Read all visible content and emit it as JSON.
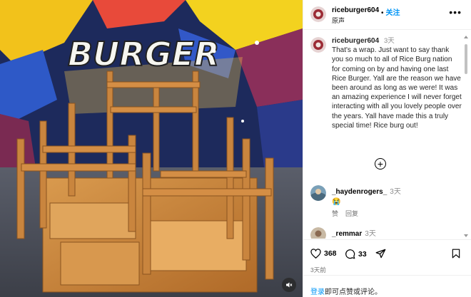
{
  "post": {
    "username": "riceburger604",
    "follow_label": "关注",
    "follow_separator": "•",
    "original_label": "原声",
    "caption": "That's a wrap. Just want to say thank you so much to all of Rice Burg nation for coming on by and having one last Rice Burger. Yall are the reason we have been around as long as we were! It was an amazing experience I will never forget interacting with all you lovely people over the years. Yall have made this a truly special time! Rice burg out!",
    "caption_time": "3天",
    "more_icon": "more-horizontal-icon",
    "mural_text": "BURGER",
    "colors": {
      "accent": "#0095f6",
      "muted": "#8e8e8e"
    }
  },
  "comments": [
    {
      "username": "_haydenrogers_",
      "time": "3天",
      "text": "😭",
      "like_label": "赞",
      "reply_label": "回复"
    },
    {
      "username": "_remmar",
      "time": "3天",
      "text": "😭😭"
    }
  ],
  "actions": {
    "likes": "368",
    "comments": "33",
    "posted_time": "3天前"
  },
  "login_prompt": {
    "link": "登录",
    "text": "即可点赞或评论。"
  }
}
